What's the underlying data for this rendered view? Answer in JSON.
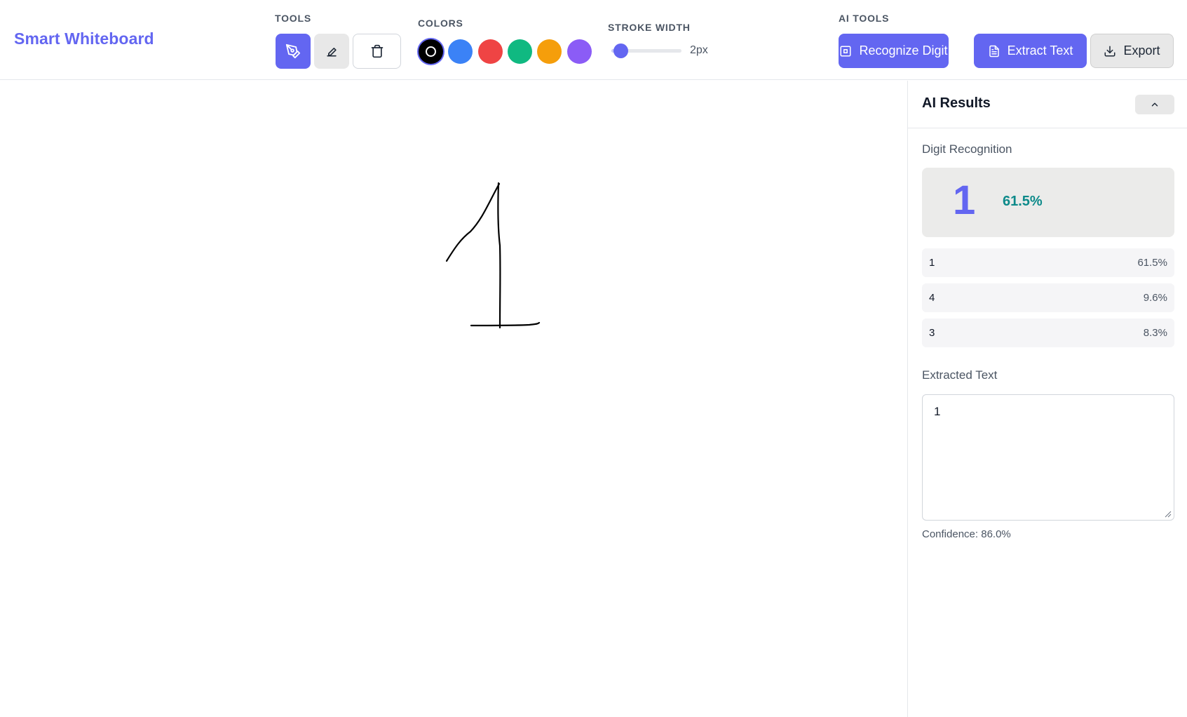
{
  "app": {
    "title": "Smart Whiteboard"
  },
  "toolbar": {
    "tools_label": "TOOLS",
    "tools": [
      {
        "name": "pen",
        "icon": "pen-icon",
        "active": true
      },
      {
        "name": "eraser",
        "icon": "eraser-icon",
        "active": false
      },
      {
        "name": "clear",
        "icon": "trash-icon",
        "active": false
      }
    ],
    "colors_label": "COLORS",
    "colors": [
      "#000000",
      "#3b82f6",
      "#ef4444",
      "#10b981",
      "#f59e0b",
      "#8b5cf6"
    ],
    "selected_color": "#000000",
    "stroke_label": "STROKE WIDTH",
    "stroke_value": "2px",
    "stroke_fraction": 0.05,
    "ai_label": "AI TOOLS",
    "recognize_label": "Recognize Digit",
    "extract_label": "Extract Text",
    "export_label": "Export"
  },
  "colors": {
    "accent": "#6366f1",
    "confidence": "#0d8a8a"
  },
  "panel": {
    "title": "AI Results",
    "digit_section": "Digit Recognition",
    "top_digit": "1",
    "top_confidence": "61.5%",
    "predictions": [
      {
        "digit": "1",
        "confidence": "61.5%"
      },
      {
        "digit": "4",
        "confidence": "9.6%"
      },
      {
        "digit": "3",
        "confidence": "8.3%"
      }
    ],
    "text_section": "Extracted Text",
    "extracted_text": "1",
    "text_confidence": "Confidence: 86.0%"
  }
}
